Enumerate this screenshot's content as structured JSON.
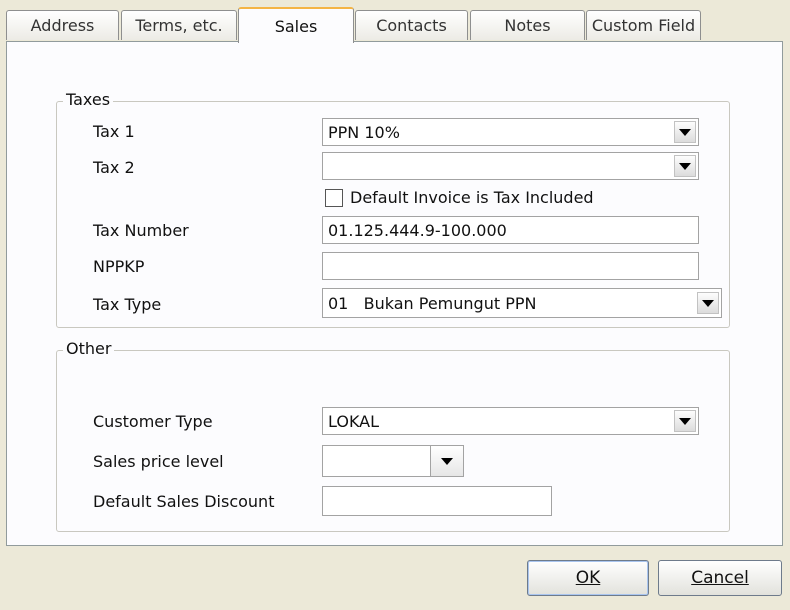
{
  "tabs": [
    {
      "label": "Address"
    },
    {
      "label": "Terms, etc."
    },
    {
      "label": "Sales",
      "active": true
    },
    {
      "label": "Contacts"
    },
    {
      "label": "Notes"
    },
    {
      "label": "Custom Field"
    }
  ],
  "taxes": {
    "legend": "Taxes",
    "tax1_label": "Tax 1",
    "tax1_value": "PPN 10%",
    "tax2_label": "Tax 2",
    "tax2_value": "",
    "tax_included_label": "Default Invoice is Tax Included",
    "tax_included_checked": false,
    "tax_number_label": "Tax Number",
    "tax_number_value": "01.125.444.9-100.000",
    "nppkp_label": "NPPKP",
    "nppkp_value": "",
    "tax_type_label": "Tax Type",
    "tax_type_value": "01   Bukan Pemungut PPN"
  },
  "other": {
    "legend": "Other",
    "customer_type_label": "Customer Type",
    "customer_type_value": "LOKAL",
    "price_level_label": "Sales price level",
    "price_level_value": "",
    "discount_label": "Default Sales Discount",
    "discount_value": ""
  },
  "buttons": {
    "ok_label": "OK",
    "cancel_label": "Cancel"
  },
  "icons": {
    "dropdown": "chevron-down-icon"
  }
}
